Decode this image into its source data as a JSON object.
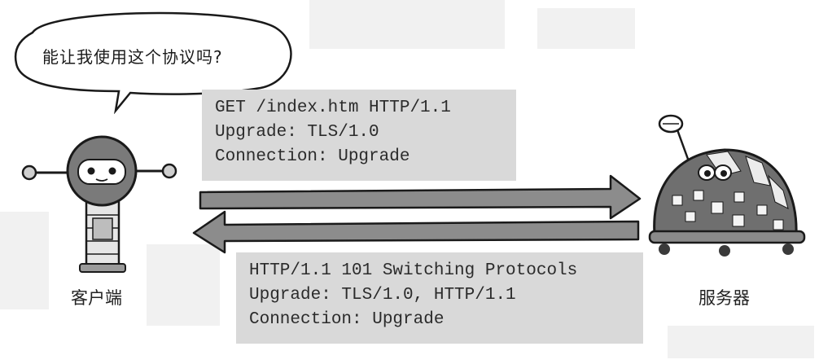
{
  "bubble": {
    "text": "能让我使用这个协议吗?"
  },
  "request": {
    "lines": [
      "GET /index.htm HTTP/1.1",
      "Upgrade: TLS/1.0",
      "Connection: Upgrade"
    ]
  },
  "response": {
    "lines": [
      "HTTP/1.1 101 Switching Protocols",
      "Upgrade: TLS/1.0, HTTP/1.1",
      "Connection: Upgrade"
    ]
  },
  "labels": {
    "client": "客户端",
    "server": "服务器"
  },
  "colors": {
    "arrow": "#8c8c8c",
    "code_bg": "#d9d9d9",
    "robot_body": "#7a7a7a",
    "outline": "#1a1a1a"
  }
}
